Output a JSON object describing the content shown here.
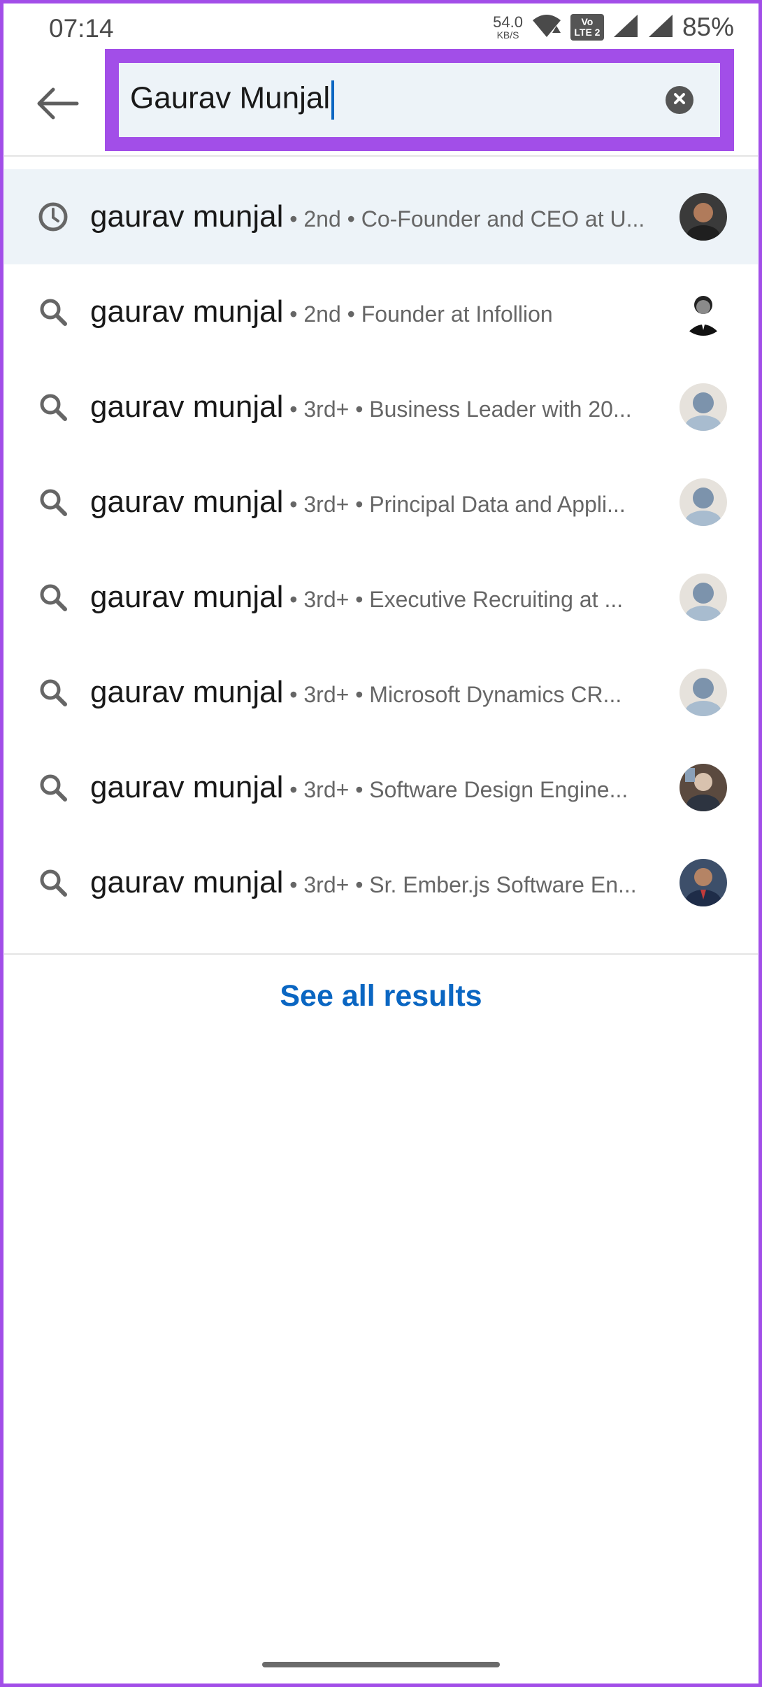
{
  "status_bar": {
    "time": "07:14",
    "net_speed_value": "54.0",
    "net_speed_unit": "KB/S",
    "volte_label": "Vo LTE 2",
    "battery": "85%"
  },
  "search": {
    "value": "Gaurav Munjal",
    "highlight_color": "#a24ee8"
  },
  "results": [
    {
      "type": "recent",
      "icon": "clock-icon",
      "name": "gaurav munjal",
      "meta": " • 2nd • Co-Founder and CEO at U..."
    },
    {
      "type": "suggestion",
      "icon": "search-icon",
      "name": "gaurav munjal",
      "meta": " • 2nd • Founder at Infollion"
    },
    {
      "type": "suggestion",
      "icon": "search-icon",
      "name": "gaurav munjal",
      "meta": " • 3rd+ • Business Leader with 20..."
    },
    {
      "type": "suggestion",
      "icon": "search-icon",
      "name": "gaurav munjal",
      "meta": " • 3rd+ • Principal Data and Appli..."
    },
    {
      "type": "suggestion",
      "icon": "search-icon",
      "name": "gaurav munjal",
      "meta": " • 3rd+ • Executive Recruiting at ..."
    },
    {
      "type": "suggestion",
      "icon": "search-icon",
      "name": "gaurav munjal",
      "meta": " • 3rd+ • Microsoft Dynamics CR..."
    },
    {
      "type": "suggestion",
      "icon": "search-icon",
      "name": "gaurav munjal",
      "meta": " • 3rd+ • Software Design Engine..."
    },
    {
      "type": "suggestion",
      "icon": "search-icon",
      "name": "gaurav munjal",
      "meta": " • 3rd+ • Sr. Ember.js Software En..."
    }
  ],
  "see_all_label": "See all results",
  "colors": {
    "accent": "#0a66c2",
    "recent_row_bg": "#edf3f8"
  }
}
